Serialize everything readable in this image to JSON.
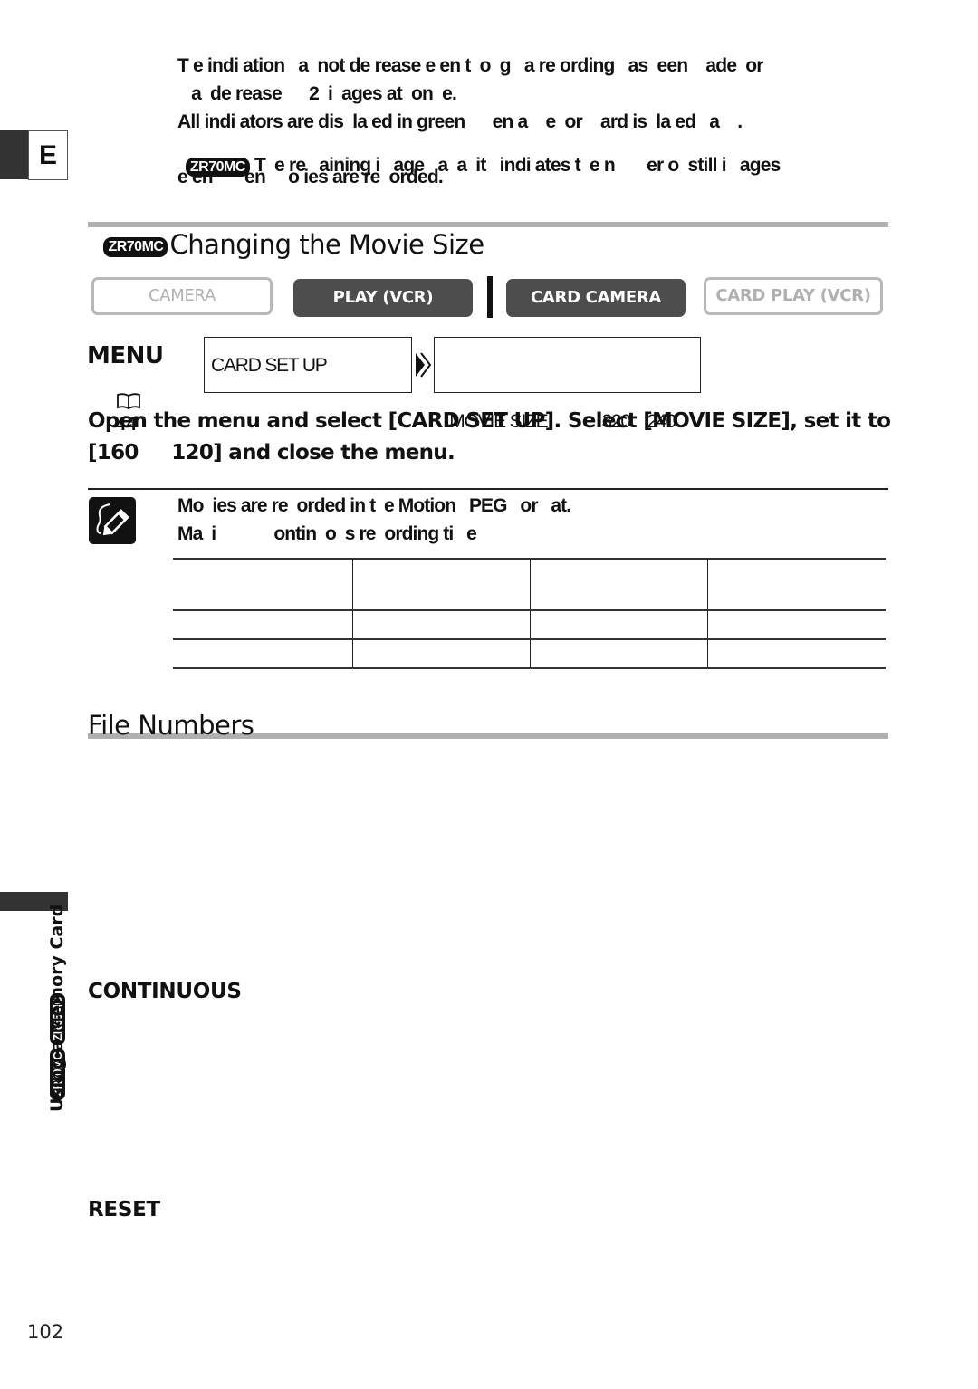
{
  "language_tab": "E",
  "intro": {
    "lines": [
      "T e indi ation   a  not de rease e en t  o  g   a re ording   as  een    ade  or",
      "   a  de rease      2  i  ages at  on  e.",
      "All indi ators are dis  la ed in green      en a    e  or    ard is  la ed   a    .",
      " T  e re   aining i   age   a  a  it   indi ates t  e n       er o  still i   ages",
      "e en       en     o ies are re  orded."
    ],
    "model_badge": "ZR70MC"
  },
  "section_movie_size": {
    "badge": "ZR70MC",
    "title": "Changing the Movie Size"
  },
  "modes": {
    "camera": "CAMERA",
    "play_vcr": "PLAY (VCR)",
    "card_camera": "CARD CAMERA",
    "card_play_vcr": "CARD PLAY (VCR)",
    "active": [
      "PLAY (VCR)",
      "CARD CAMERA"
    ]
  },
  "menu": {
    "label": "MENU",
    "page_ref_icon": "book-icon",
    "page_ref": "44",
    "box1": "CARD SET UP",
    "box2_label": "MOVIE SIZE",
    "box2_value": "320    240"
  },
  "instruction": {
    "line1": "Open the menu and select [CARD SET UP]. Select [MOVIE SIZE], set it to",
    "line2": "[160     120] and close the menu."
  },
  "note": {
    "icon": "pencil-note-icon",
    "line1": "Mo  ies are re  orded in t  e Motion   PEG   or   at.",
    "line2": "Ma  i             ontin  o  s re  ording ti   e"
  },
  "table": {
    "rows": [
      [
        "",
        "",
        "",
        ""
      ],
      [
        "",
        "",
        "",
        ""
      ],
      [
        "",
        "",
        "",
        ""
      ]
    ]
  },
  "section_file_numbers": {
    "title": "File Numbers"
  },
  "subheads": {
    "continuous": "CONTINUOUS",
    "reset": "RESET"
  },
  "sidebar": {
    "chapter": "Using a Memory Card",
    "badges": [
      "ZR70MC",
      "ZR65MC"
    ]
  },
  "page_number": "102"
}
